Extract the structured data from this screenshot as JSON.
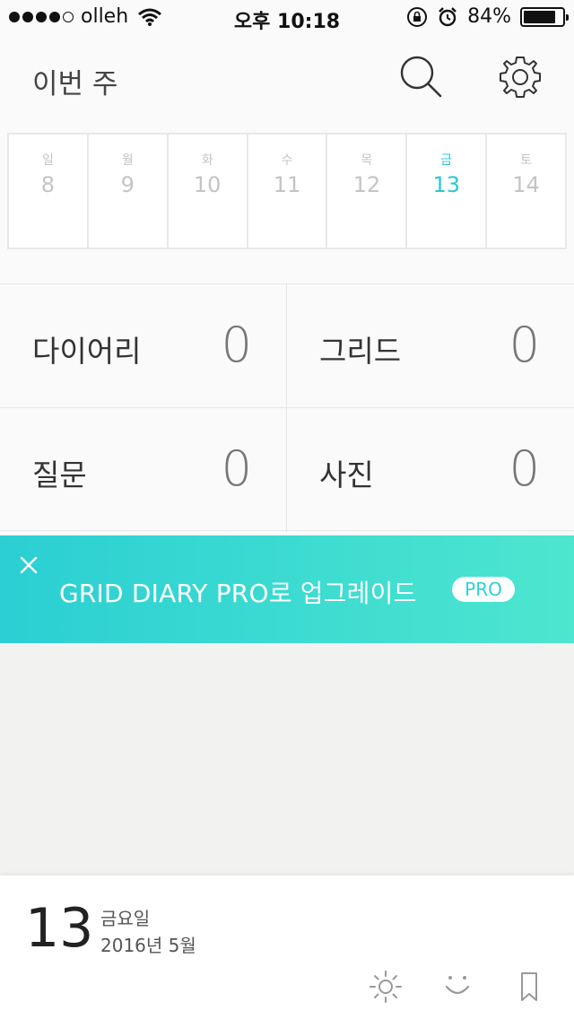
{
  "status_bar": {
    "carrier": "olleh",
    "time": "오후 10:18",
    "battery": "84%",
    "battery_level": 0.84
  },
  "header": {
    "title": "이번 주",
    "search_icon": "search-icon",
    "settings_icon": "gear-icon"
  },
  "week": {
    "days": [
      {
        "name": "일",
        "num": "8"
      },
      {
        "name": "월",
        "num": "9"
      },
      {
        "name": "화",
        "num": "10"
      },
      {
        "name": "수",
        "num": "11"
      },
      {
        "name": "목",
        "num": "12"
      },
      {
        "name": "금",
        "num": "13"
      },
      {
        "name": "토",
        "num": "14"
      }
    ],
    "selected_index": 5
  },
  "stats": [
    {
      "label": "다이어리",
      "count": "0"
    },
    {
      "label": "그리드",
      "count": "0"
    },
    {
      "label": "질문",
      "count": "0"
    },
    {
      "label": "사진",
      "count": "0"
    }
  ],
  "banner": {
    "text": "GRID DIARY PRO로 업그레이드",
    "badge": "PRO"
  },
  "bottom": {
    "day": "13",
    "weekday": "금요일",
    "date": "2016년 5월",
    "icons": [
      "sun-icon",
      "smile-icon",
      "bookmark-icon"
    ]
  },
  "colors": {
    "accent": "#2bc8cf",
    "banner_start": "#2bcfd3",
    "banner_end": "#4de6cf"
  }
}
